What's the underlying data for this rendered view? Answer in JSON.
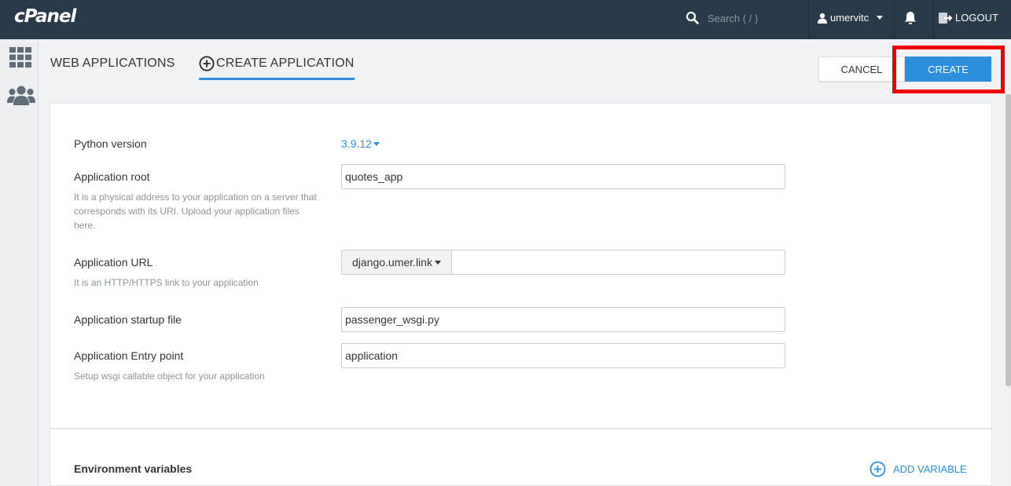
{
  "topbar": {
    "logo": "cPanel",
    "search_placeholder": "Search ( / )",
    "username": "umervitc",
    "logout_label": "LOGOUT"
  },
  "tabs": {
    "web_applications": "WEB APPLICATIONS",
    "create_application": "CREATE APPLICATION"
  },
  "actions": {
    "cancel": "CANCEL",
    "create": "CREATE"
  },
  "form": {
    "python_version": {
      "label": "Python version",
      "value": "3.9.12"
    },
    "app_root": {
      "label": "Application root",
      "help": "It is a physical address to your application on a server that corresponds with its URI. Upload your application files here.",
      "value": "quotes_app"
    },
    "app_url": {
      "label": "Application URL",
      "help": "It is an HTTP/HTTPS link to your application",
      "domain": "django.umer.link",
      "path": ""
    },
    "startup_file": {
      "label": "Application startup file",
      "value": "passenger_wsgi.py"
    },
    "entry_point": {
      "label": "Application Entry point",
      "help": "Setup wsgi callable object for your application",
      "value": "application"
    }
  },
  "env": {
    "title": "Environment variables",
    "add_label": "ADD VARIABLE"
  },
  "colors": {
    "topbar": "#293a4a",
    "accent": "#2b8fde",
    "highlight": "#ee0000"
  }
}
